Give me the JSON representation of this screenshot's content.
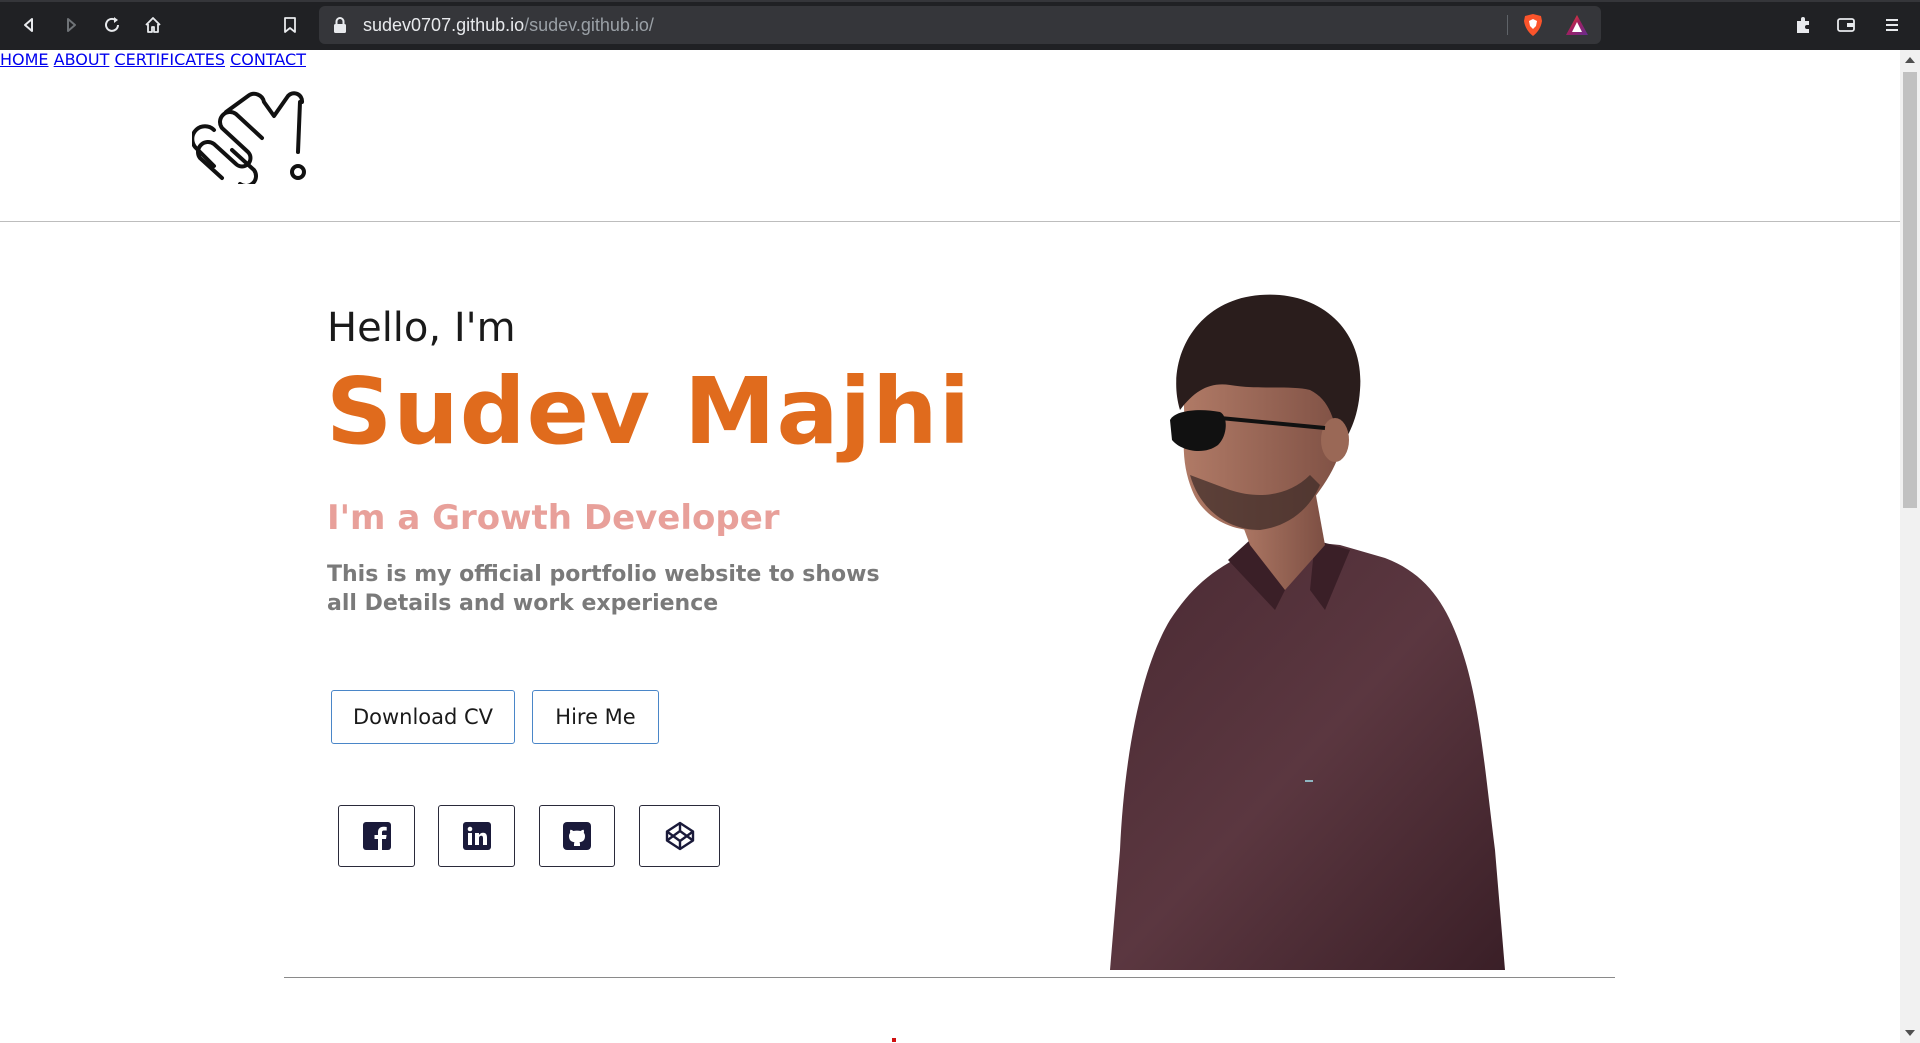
{
  "browser": {
    "url_domain": "sudev0707.github.io",
    "url_path": "/sudev.github.io/"
  },
  "nav": {
    "items": [
      {
        "label": "HOME"
      },
      {
        "label": "ABOUT"
      },
      {
        "label": "CERTIFICATES"
      },
      {
        "label": "CONTACT"
      }
    ]
  },
  "hero": {
    "greeting": "Hello, I'm",
    "name": "Sudev Majhi",
    "role": "I'm a Growth Developer",
    "description": "This is my official portfolio website to shows all Details and work experience",
    "download_cv": "Download CV",
    "hire_me": "Hire Me"
  },
  "social": [
    {
      "icon": "facebook-icon"
    },
    {
      "icon": "linkedin-icon"
    },
    {
      "icon": "github-icon"
    },
    {
      "icon": "codepen-icon"
    }
  ],
  "colors": {
    "accent": "#e06b1d",
    "role": "#e8a09a",
    "button_border": "#4a86c8",
    "chrome": "#202124"
  }
}
